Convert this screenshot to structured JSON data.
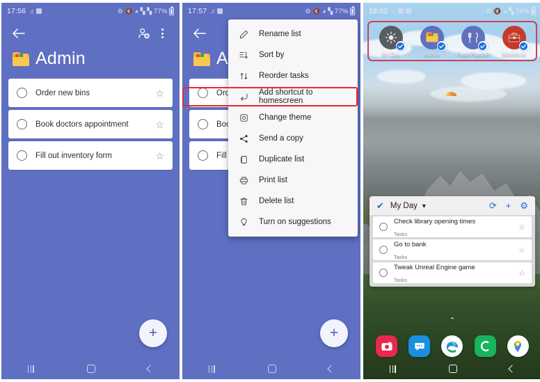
{
  "panels": {
    "list_screen": {
      "status": {
        "time": "17:56",
        "battery_pct": "77%",
        "icons": [
          "music-note-icon",
          "photo-icon",
          "bluetooth-icon",
          "mute-icon",
          "wifi-icon",
          "signal-icon",
          "signal2-icon"
        ]
      },
      "appbar": {
        "back_label": "←",
        "share_people_name": "add-people-icon",
        "overflow_name": "overflow-menu-icon"
      },
      "title": "Admin",
      "title_icon": "folder-icon",
      "tasks": [
        {
          "text": "Order new bins",
          "starred": false
        },
        {
          "text": "Book doctors appointment",
          "starred": false
        },
        {
          "text": "Fill out inventory form",
          "starred": false
        }
      ],
      "fab_label": "+",
      "nav": [
        "recents-button",
        "home-button",
        "back-button"
      ]
    },
    "menu_screen": {
      "status": {
        "time": "17:57",
        "battery_pct": "77%"
      },
      "title": "Admin",
      "tasks": [
        {
          "text": "Order new bins"
        },
        {
          "text": "Book doctors appointment"
        },
        {
          "text": "Fill out inventory form"
        }
      ],
      "menu_items": [
        {
          "label": "Rename list",
          "icon": "pencil-icon",
          "highlighted": false
        },
        {
          "label": "Sort by",
          "icon": "sort-icon",
          "highlighted": false
        },
        {
          "label": "Reorder tasks",
          "icon": "reorder-arrows-icon",
          "highlighted": false
        },
        {
          "label": "Add shortcut to homescreen",
          "icon": "shortcut-arrow-icon",
          "highlighted": true
        },
        {
          "label": "Change theme",
          "icon": "theme-palette-icon",
          "highlighted": false
        },
        {
          "label": "Send a copy",
          "icon": "share-icon",
          "highlighted": false
        },
        {
          "label": "Duplicate list",
          "icon": "duplicate-icon",
          "highlighted": false
        },
        {
          "label": "Print list",
          "icon": "printer-icon",
          "highlighted": false
        },
        {
          "label": "Delete list",
          "icon": "trash-icon",
          "highlighted": false
        },
        {
          "label": "Turn on suggestions",
          "icon": "lightbulb-icon",
          "highlighted": false
        }
      ],
      "fab_label": "+"
    },
    "home_screen": {
      "status": {
        "time": "18:02",
        "battery_pct": "76%"
      },
      "shortcuts": [
        {
          "label": "My Day",
          "icon": "sun-icon",
          "color": "#585c63"
        },
        {
          "label": "Admin",
          "icon": "folder-icon",
          "color": "#6070bd"
        },
        {
          "label": "Food Planner",
          "icon": "cutlery-icon",
          "color": "#6070bd"
        },
        {
          "label": "Moving in",
          "icon": "toolbox-icon",
          "color": "#c63a2c"
        }
      ],
      "widget": {
        "check_icon": "check-icon",
        "title": "My Day",
        "caret": "⌄",
        "actions": [
          "refresh-icon",
          "add-icon",
          "settings-gear-icon"
        ],
        "items": [
          {
            "title": "Check library opening times",
            "subtitle": "Tasks"
          },
          {
            "title": "Go to bank",
            "subtitle": "Tasks"
          },
          {
            "title": "Tweak Unreal Engine game",
            "subtitle": "Tasks"
          }
        ]
      },
      "page_arrow": "⌃",
      "dock": [
        {
          "name": "camera-icon",
          "color": "#e8294d"
        },
        {
          "name": "messages-icon",
          "color": "#1a8fe0"
        },
        {
          "name": "edge-icon",
          "color": "#ffffff"
        },
        {
          "name": "phone-icon",
          "color": "#19b45e"
        },
        {
          "name": "maps-icon",
          "color": "#ffffff"
        }
      ],
      "nav": [
        "recents-button",
        "home-button",
        "back-button"
      ]
    }
  },
  "theme": {
    "app_purple": "#5f6fc2",
    "highlight_red": "#e8282a",
    "shortcut_outline": "#c9405d",
    "widget_accent": "#2871cd"
  }
}
